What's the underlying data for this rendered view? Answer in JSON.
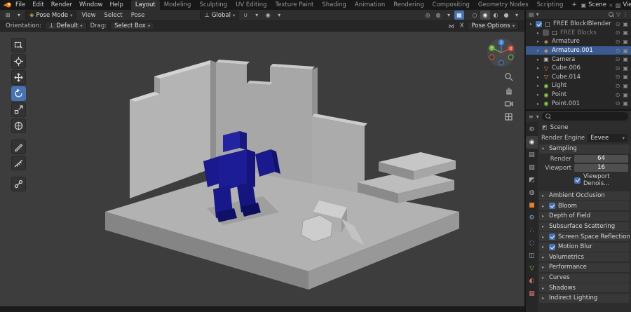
{
  "topbar": {
    "menus": [
      "File",
      "Edit",
      "Render",
      "Window",
      "Help"
    ],
    "workspaces": [
      "Layout",
      "Modeling",
      "Sculpting",
      "UV Editing",
      "Texture Paint",
      "Shading",
      "Animation",
      "Rendering",
      "Compositing",
      "Geometry Nodes",
      "Scripting"
    ],
    "active_workspace": "Layout",
    "add_tab": "+",
    "scene": "Scene",
    "view_layer": "ViewLayer"
  },
  "viewport_header": {
    "mode": "Pose Mode",
    "menus": [
      "View",
      "Select",
      "Pose"
    ],
    "orientation": "Global"
  },
  "tool_settings": {
    "orientation_label": "Orientation:",
    "orientation_value": "Default",
    "drag_label": "Drag:",
    "drag_value": "Select Box",
    "mirror_x_label": "X",
    "pose_options": "Pose Options"
  },
  "toolbar": {
    "tools": [
      "Select Box",
      "Cursor",
      "Move",
      "Rotate",
      "Scale",
      "Transform",
      "Annotate",
      "Measure",
      "Pose Breakdowner"
    ],
    "active_tool": "Rotate"
  },
  "outliner": {
    "items": [
      {
        "label": "FREE BlockIBlender",
        "icon": "□",
        "type": "collection",
        "checked": true
      },
      {
        "label": "FREE Blocks",
        "icon": "□",
        "type": "collection",
        "checked": false,
        "dimmed": true
      },
      {
        "label": "Armature",
        "icon": "◈",
        "type": "armature"
      },
      {
        "label": "Armature.001",
        "icon": "◈",
        "type": "armature",
        "selected": true
      },
      {
        "label": "Camera",
        "icon": "▣",
        "type": "camera"
      },
      {
        "label": "Cube.006",
        "icon": "▽",
        "type": "mesh"
      },
      {
        "label": "Cube.014",
        "icon": "▽",
        "type": "mesh"
      },
      {
        "label": "Light",
        "icon": "◉",
        "type": "light"
      },
      {
        "label": "Point",
        "icon": "◉",
        "type": "light"
      },
      {
        "label": "Point.001",
        "icon": "◉",
        "type": "light"
      }
    ]
  },
  "properties": {
    "breadcrumb": "Scene",
    "render_engine_label": "Render Engine",
    "render_engine_value": "Eevee",
    "sampling": {
      "title": "Sampling",
      "render_label": "Render",
      "render_value": "64",
      "viewport_label": "Viewport",
      "viewport_value": "16",
      "denoise_label": "Viewport Denois..."
    },
    "sections": [
      {
        "label": "Ambient Occlusion",
        "checkbox": false
      },
      {
        "label": "Bloom",
        "checkbox": true,
        "checked": true
      },
      {
        "label": "Depth of Field",
        "checkbox": false
      },
      {
        "label": "Subsurface Scattering",
        "checkbox": false
      },
      {
        "label": "Screen Space Reflections",
        "checkbox": true,
        "checked": true
      },
      {
        "label": "Motion Blur",
        "checkbox": true,
        "checked": true
      },
      {
        "label": "Volumetrics",
        "checkbox": false
      },
      {
        "label": "Performance",
        "checkbox": false
      },
      {
        "label": "Curves",
        "checkbox": false
      },
      {
        "label": "Shadows",
        "checkbox": false
      },
      {
        "label": "Indirect Lighting",
        "checkbox": false
      }
    ],
    "tabs": [
      {
        "name": "tool",
        "glyph": "⚙"
      },
      {
        "name": "render",
        "glyph": "◉",
        "active": true
      },
      {
        "name": "output",
        "glyph": "▤"
      },
      {
        "name": "view-layer",
        "glyph": "▧"
      },
      {
        "name": "scene",
        "glyph": "◩"
      },
      {
        "name": "world",
        "glyph": "◍"
      },
      {
        "name": "object",
        "glyph": "■"
      },
      {
        "name": "modifiers",
        "glyph": "⚙"
      },
      {
        "name": "particles",
        "glyph": "∴"
      },
      {
        "name": "physics",
        "glyph": "◌"
      },
      {
        "name": "constraints",
        "glyph": "◫"
      },
      {
        "name": "object-data",
        "glyph": "▽"
      },
      {
        "name": "material",
        "glyph": "◐"
      },
      {
        "name": "texture",
        "glyph": "▦"
      }
    ]
  },
  "icons": {
    "chev_down": "▾",
    "chev_right": "▸",
    "editor_3d": "⊞",
    "editor_outliner": "▤",
    "editor_props": "≡",
    "mode_pose": "◈",
    "orient": "⊥",
    "magnet": "∪",
    "prop_edit": "◉",
    "gizmo_toggle": "◎",
    "overlay": "◍",
    "xray": "▦",
    "shade_wire": "○",
    "shade_solid": "◉",
    "shade_material": "◐",
    "shade_render": "●",
    "scene": "▣",
    "viewlayer": "▧",
    "funnel": "▽",
    "dots": "⋮",
    "eye": "⊙",
    "render_vis": "▣",
    "mirror": "⋈",
    "crumb_scene": "◩",
    "close": "×"
  },
  "colors": {
    "accent": "#4772b3",
    "selection": "#3a5a90",
    "viewport_bg": "#3d3d3d"
  }
}
